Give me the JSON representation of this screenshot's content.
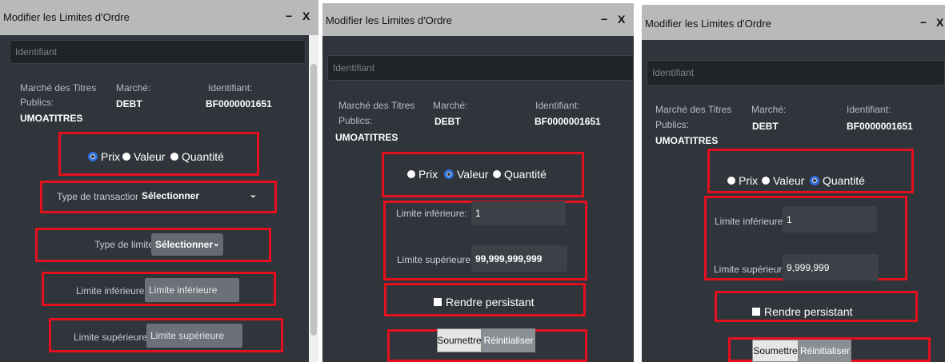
{
  "window_title": "Modifier les Limites d'Ordre",
  "minimize_glyph": "−",
  "close_glyph": "X",
  "identifiant_placeholder": "Identifiant",
  "info": {
    "marche_titres": "Marché des Titres",
    "publics": "Publics:",
    "umoa": "UMOATITRES",
    "marche_label": "Marché:",
    "marche_value": "DEBT",
    "identifiant_label": "Identifiant:",
    "identifiant_value": "BF0000001651"
  },
  "radios": {
    "prix": "Prix",
    "valeur": "Valeur",
    "quantite": "Quantité"
  },
  "panel1": {
    "selected_radio": "prix",
    "type_transaction_label": "Type de transaction:",
    "type_transaction_value": "Sélectionner",
    "type_limite_label": "Type de limite:",
    "type_limite_value": "Sélectionner",
    "limite_inf_label": "Limite inférieure:",
    "limite_inf_placeholder": "Limite inférieure",
    "limite_sup_label": "Limite supérieure:",
    "limite_sup_placeholder": "Limite supérieure"
  },
  "panel2": {
    "selected_radio": "valeur",
    "limite_inf_label": "Limite inférieure:",
    "limite_inf_value": "1",
    "limite_sup_label": "Limite supérieure:",
    "limite_sup_value": "99,999,999,999",
    "persist_label": "Rendre persistant",
    "submit_label": "Soumettre",
    "reset_label": "Réinitialiser"
  },
  "panel3": {
    "selected_radio": "quantite",
    "limite_inf_label": "Limite inférieure:",
    "limite_inf_value": "1",
    "limite_sup_label": "Limite supérieure:",
    "limite_sup_value": "9,999,999",
    "persist_label": "Rendre persistant",
    "submit_label": "Soumettre",
    "reset_label": "Réinitialiser"
  },
  "colors": {
    "panel_bg": "#30343b",
    "titlebar_bg": "#b9b9b9",
    "highlight_red": "#e3101e",
    "radio_selected": "#2f6fe0"
  }
}
